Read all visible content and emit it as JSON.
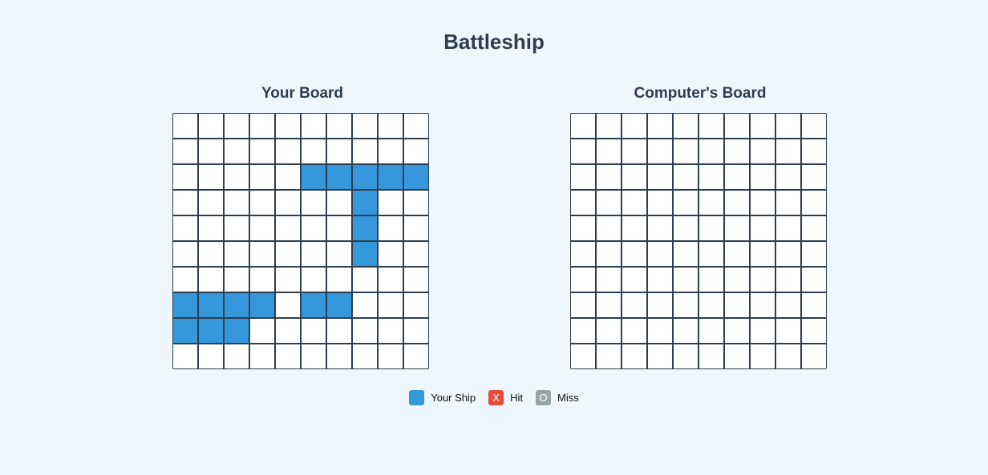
{
  "title": "Battleship",
  "player_board": {
    "title": "Your Board",
    "ship_cells": [
      [
        2,
        5
      ],
      [
        2,
        6
      ],
      [
        2,
        7
      ],
      [
        2,
        8
      ],
      [
        2,
        9
      ],
      [
        3,
        7
      ],
      [
        4,
        7
      ],
      [
        5,
        7
      ],
      [
        7,
        0
      ],
      [
        7,
        1
      ],
      [
        7,
        2
      ],
      [
        7,
        3
      ],
      [
        7,
        5
      ],
      [
        7,
        6
      ],
      [
        8,
        0
      ],
      [
        8,
        1
      ],
      [
        8,
        2
      ]
    ],
    "hit_cells": [],
    "miss_cells": []
  },
  "computer_board": {
    "title": "Computer's Board",
    "hit_cells": [],
    "miss_cells": []
  },
  "legend": {
    "ship": {
      "label": "Your Ship",
      "symbol": "",
      "color": "#3498db"
    },
    "hit": {
      "label": "Hit",
      "symbol": "X",
      "color": "#e74c3c"
    },
    "miss": {
      "label": "Miss",
      "symbol": "O",
      "color": "#95a5a6"
    }
  }
}
